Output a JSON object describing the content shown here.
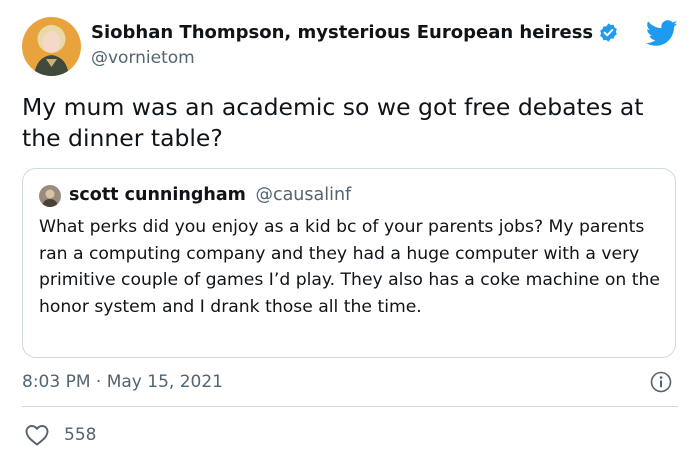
{
  "author": {
    "name": "Siobhan Thompson, mysterious European heiress",
    "handle": "@vornietom",
    "verified": true,
    "avatar_icon": "portrait-avatar"
  },
  "tweet_text": "My mum was an academic so we got free debates at the dinner table?",
  "quoted_tweet": {
    "name": "scott cunningham",
    "handle": "@causalinf",
    "text": "What perks did you enjoy as a kid bc of your parents jobs? My parents ran a computing company and they had a huge computer with a very primitive couple of games I’d play. They also has a coke machine on the honor system and I drank those all the time."
  },
  "timestamp": "8:03 PM · May 15, 2021",
  "likes": "558",
  "colors": {
    "brand_blue": "#1d9bf0",
    "text_primary": "#0f1419",
    "text_secondary": "#536471",
    "border": "#cfd9de"
  },
  "icons": {
    "verified": "verified-badge-icon",
    "logo": "twitter-bird-icon",
    "info": "info-icon",
    "like": "heart-icon"
  }
}
